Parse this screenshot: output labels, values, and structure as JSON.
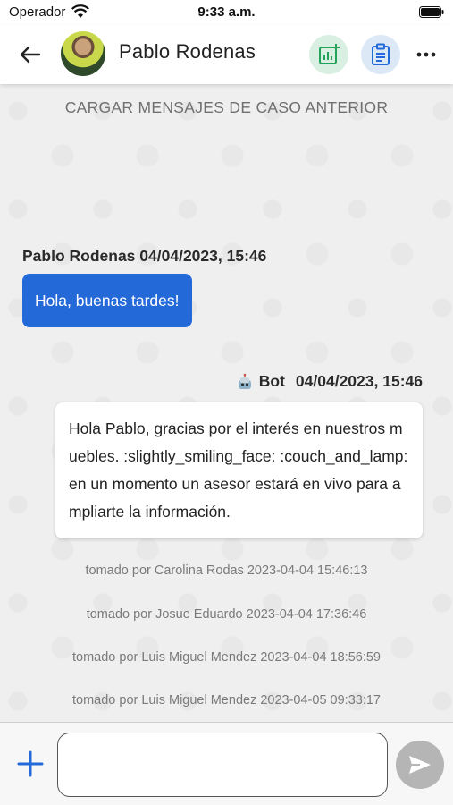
{
  "status_bar": {
    "carrier": "Operador",
    "time": "9:33 a.m."
  },
  "header": {
    "contact_name": "Pablo Rodenas",
    "icons": {
      "back": "arrow-left-icon",
      "stats": "chart-add-icon",
      "clipboard": "clipboard-icon",
      "more": "more-dots-icon"
    },
    "colors": {
      "stats_bg": "#d9efe2",
      "stats_fg": "#23a35a",
      "clipboard_bg": "#dde8f7",
      "clipboard_fg": "#2469d8"
    }
  },
  "chat": {
    "load_previous_label": "CARGAR MENSAJES DE CASO ANTERIOR",
    "messages": [
      {
        "sender": "Pablo Rodenas",
        "timestamp": "04/04/2023, 15:46",
        "text": "Hola, buenas tardes!"
      },
      {
        "sender": "Bot",
        "timestamp": "04/04/2023, 15:46",
        "text": "Hola Pablo, gracias por el interés en nuestros muebles. :slightly_smiling_face: :couch_and_lamp: en un momento un asesor estará en vivo para ampliarte la información."
      }
    ],
    "taken_by": [
      "tomado por Carolina Rodas 2023-04-04 15:46:13",
      "tomado por Josue Eduardo 2023-04-04 17:36:46",
      "tomado por Luis Miguel Mendez 2023-04-04 18:56:59",
      "tomado por Luis Miguel Mendez 2023-04-05 09:33:17"
    ],
    "colors": {
      "user_bubble": "#2469d8",
      "bot_bubble": "#ffffff"
    }
  },
  "composer": {
    "input_value": "",
    "icons": {
      "add": "plus-icon",
      "send": "send-icon"
    },
    "colors": {
      "add": "#2469d8",
      "send_bg": "#b5b5b5"
    }
  }
}
